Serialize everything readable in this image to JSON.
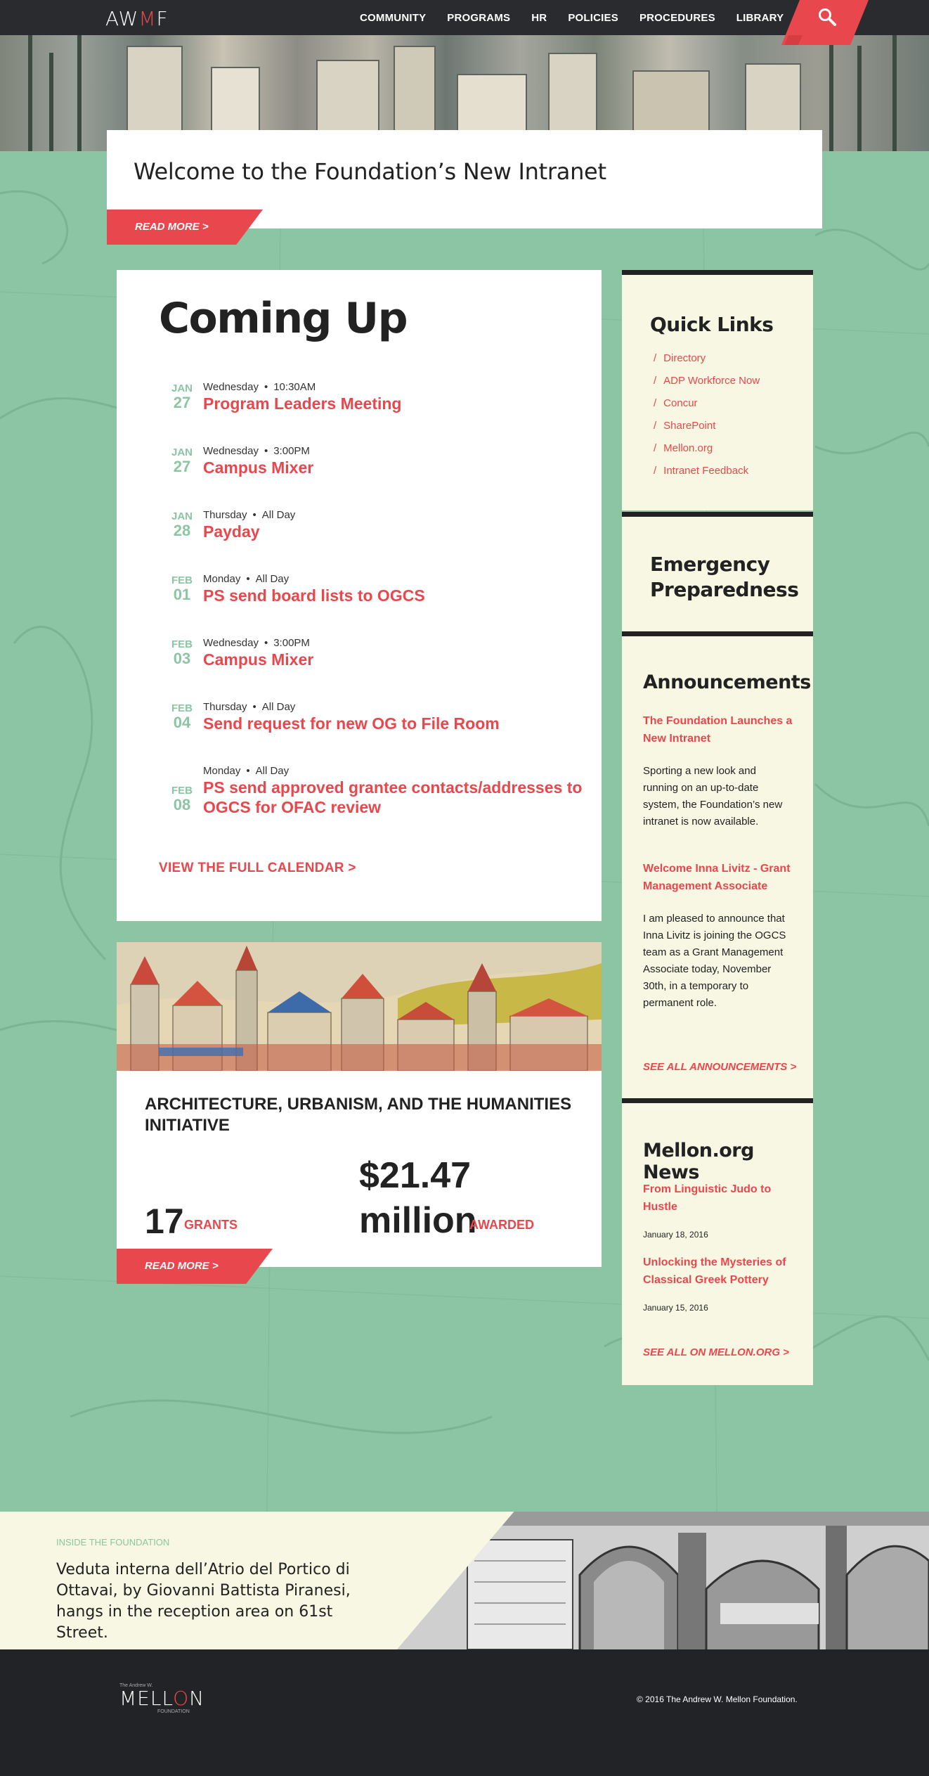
{
  "nav": {
    "logo_prefix": "AW",
    "logo_m": "M",
    "logo_suffix": "F",
    "links": [
      "COMMUNITY",
      "PROGRAMS",
      "HR",
      "POLICIES",
      "PROCEDURES",
      "LIBRARY"
    ],
    "search_icon": "search-icon"
  },
  "welcome": {
    "title": "Welcome to the Foundation’s New Intranet",
    "read_more": "READ MORE >"
  },
  "coming_up": {
    "heading": "Coming Up",
    "events": [
      {
        "month": "JAN",
        "day": "27",
        "weekday": "Wednesday",
        "time": "10:30AM",
        "title": "Program Leaders Meeting"
      },
      {
        "month": "JAN",
        "day": "27",
        "weekday": "Wednesday",
        "time": "3:00PM",
        "title": "Campus Mixer"
      },
      {
        "month": "JAN",
        "day": "28",
        "weekday": "Thursday",
        "time": "All Day",
        "title": "Payday"
      },
      {
        "month": "FEB",
        "day": "01",
        "weekday": "Monday",
        "time": "All Day",
        "title": "PS send board lists to OGCS"
      },
      {
        "month": "FEB",
        "day": "03",
        "weekday": "Wednesday",
        "time": "3:00PM",
        "title": "Campus Mixer"
      },
      {
        "month": "FEB",
        "day": "04",
        "weekday": "Thursday",
        "time": "All Day",
        "title": "Send request for new OG to File Room"
      },
      {
        "month": "FEB",
        "day": "08",
        "weekday": "Monday",
        "time": "All Day",
        "title": "PS send approved grantee contacts/addresses to OGCS for OFAC review"
      }
    ],
    "view_calendar": "VIEW THE FULL CALENDAR  >"
  },
  "initiative": {
    "title": "ARCHITECTURE, URBANISM, AND THE HUMANITIES INITIATIVE",
    "grants_count": "17",
    "grants_label": "GRANTS",
    "amount": "$21.47",
    "amount_unit": "million",
    "amount_label": "AWARDED",
    "read_more": "READ MORE >"
  },
  "quick_links": {
    "heading": "Quick Links",
    "separator": "/",
    "items": [
      "Directory",
      "ADP Workforce Now",
      "Concur",
      "SharePoint",
      "Mellon.org",
      "Intranet Feedback"
    ]
  },
  "emergency": {
    "heading_line1": "Emergency",
    "heading_line2": "Preparedness"
  },
  "announcements": {
    "heading": "Announcements",
    "items": [
      {
        "title": "The Foundation Launches a New Intranet",
        "body": "Sporting a new look and running on an up-to-date system, the Foundation’s new intranet is now available."
      },
      {
        "title": "Welcome Inna Livitz - Grant Management Associate",
        "body": "I am pleased to announce that Inna Livitz is joining the OGCS team as a Grant Management Associate today, November 30th, in a temporary to permanent role."
      }
    ],
    "see_all": "SEE ALL ANNOUNCEMENTS  >"
  },
  "news": {
    "heading": "Mellon.org News",
    "items": [
      {
        "title": "From Linguistic Judo to Hustle",
        "date": "January 18, 2016"
      },
      {
        "title": "Unlocking the Mysteries of Classical Greek Pottery",
        "date": "January 15, 2016"
      }
    ],
    "see_all": "SEE ALL ON MELLON.ORG  >"
  },
  "inside": {
    "label": "INSIDE THE FOUNDATION",
    "text": "Veduta interna dell’Atrio del Portico di Ottavai, by Giovanni Battista Piranesi, hangs in the reception area on 61st Street."
  },
  "footer": {
    "logo_top": "The Andrew W.",
    "logo_prefix": "MELL",
    "logo_o": "O",
    "logo_suffix": "N",
    "logo_sub": "FOUNDATION",
    "copyright": "© 2016 The Andrew W. Mellon Foundation."
  },
  "colors": {
    "accent": "#e8484d",
    "green": "#8cc5a3",
    "dark": "#2a2b2e",
    "cream": "#f7f7e3"
  }
}
